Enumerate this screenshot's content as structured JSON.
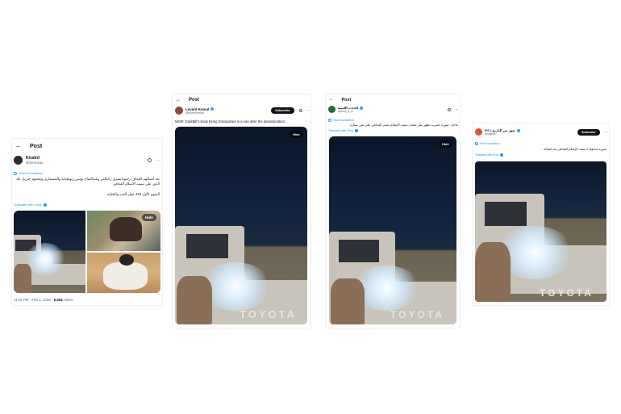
{
  "card1": {
    "header": "Post",
    "author": "Khalid",
    "handle": "@bennzan",
    "translation_link": "Show translation",
    "text_line1": "بعد اغتيالهم القذاف رخنوداشتري رجبالتي وعبدالفتاح يونس ربومليانة والمسماري ومحمود جبريل عاد",
    "text_line2": "الدور على سيف الاسلام القذافي",
    "text_line3": "المتهم الأول 444 جهاز الغدر والخيانة",
    "grok_link": "Translate with Grok",
    "hide_label": "Hide",
    "time": "11:05 PM · Feb 2, 2026",
    "views_count": "5,654",
    "views_label": "Views"
  },
  "card2": {
    "header": "Post",
    "author": "Levent Kemal",
    "handle": "@leventkemal",
    "subscribe": "Subscribe",
    "text": "NEW: Gaddafi's body being transported in a van after the assassination.",
    "hide_label": "Hide",
    "plate": "TOYOTA"
  },
  "card3": {
    "header": "Post",
    "author": "الحدث الليبية",
    "handle": "@ALD_H_N",
    "translation_link": "Show translation",
    "text": "عاجل: صورة حصرية تظهر نقل جثمان سيف الإسلام معمر القذافي على متن سيارة",
    "grok_link": "Translate with Grok",
    "hide_label": "Hide",
    "plate": "TOYOTA"
  },
  "card4": {
    "author": "PIC | صور من التاريخ",
    "handle": "@oldpic8",
    "subscribe": "Subscribe",
    "translation_link": "Show translation",
    "text": "صورة متداولة لـ سيف الإسلام القذافي بعد اغتياله .",
    "grok_link": "Translate with Grok",
    "plate": "TOYOTA"
  },
  "colors": {
    "accent": "#1d9bf0",
    "text": "#0f1419",
    "muted": "#536471"
  }
}
